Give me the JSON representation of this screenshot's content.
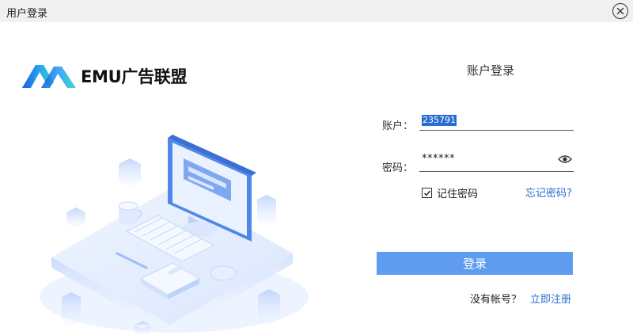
{
  "window": {
    "title": "用户登录"
  },
  "logo": {
    "text": "EMU广告联盟",
    "colors": [
      "#1a5fd8",
      "#2ba3f5",
      "#2fd6c5"
    ]
  },
  "login": {
    "heading": "账户登录",
    "account_label": "账户：",
    "account_value": "235791",
    "password_label": "密码：",
    "password_value": "******",
    "remember_label": "记住密码",
    "remember_checked": true,
    "forgot_link": "忘记密码?",
    "submit_label": "登录",
    "no_account_text": "没有帐号？",
    "register_link": "立即注册"
  },
  "icons": {
    "close": "close-icon",
    "eye": "eye-icon",
    "checkbox": "checkbox-icon"
  },
  "colors": {
    "accent": "#5f9cf0",
    "link": "#2a6dd0",
    "selection": "#2a6dd0"
  }
}
